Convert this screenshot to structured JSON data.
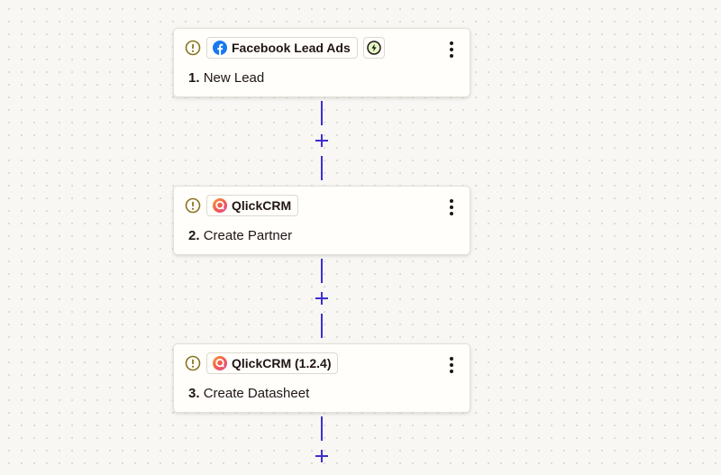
{
  "steps": [
    {
      "number": "1.",
      "title": "New Lead",
      "app": "Facebook Lead Ads",
      "app_icon": "facebook-icon",
      "warning_icon": "warning-icon",
      "trigger_icon": "lightning-bolt-icon",
      "menu_icon": "more-vertical-icon"
    },
    {
      "number": "2.",
      "title": "Create Partner",
      "app": "QlickCRM",
      "app_icon": "qlickcrm-logo-icon",
      "warning_icon": "warning-icon",
      "menu_icon": "more-vertical-icon"
    },
    {
      "number": "3.",
      "title": "Create Datasheet",
      "app": "QlickCRM (1.2.4)",
      "app_icon": "qlickcrm-logo-icon",
      "warning_icon": "warning-icon",
      "menu_icon": "more-vertical-icon"
    }
  ],
  "add_step_icon": "plus-icon",
  "colors": {
    "connector": "#3d2fcf",
    "warning": "#8a7422",
    "trigger_bg": "#e4f9c6",
    "facebook": "#1877f2",
    "qlick_gradient_start": "#f25c4d",
    "qlick_gradient_end": "#e14a9a"
  }
}
